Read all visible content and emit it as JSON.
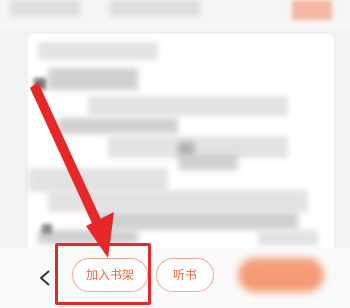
{
  "bottom_bar": {
    "add_to_shelf_label": "加入书架",
    "listen_label": "听书"
  },
  "colors": {
    "accent": "#e96838",
    "annotation": "#e62828"
  }
}
